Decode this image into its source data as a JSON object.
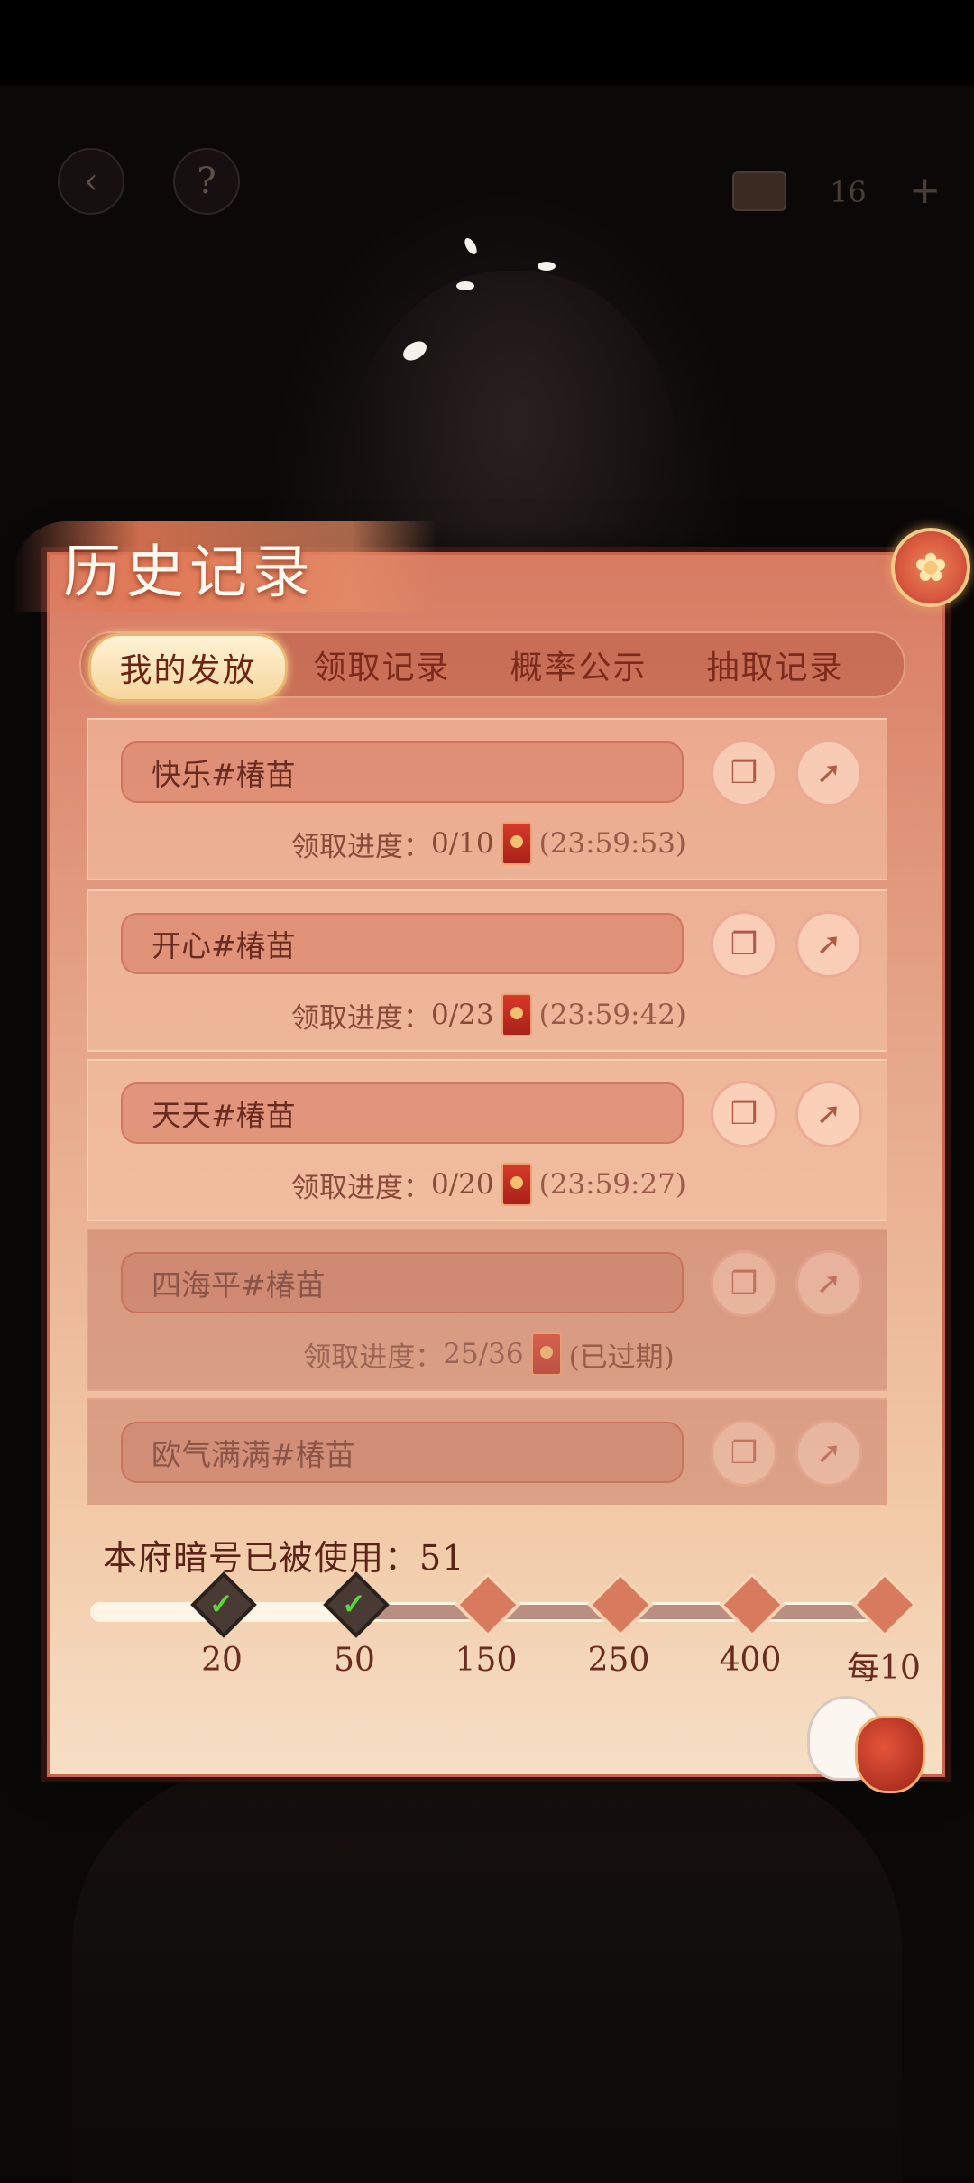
{
  "top_hud": {
    "back_icon": "back-arrow-icon",
    "help_icon": "question-icon",
    "currency_icon": "chest-icon",
    "currency_value": "16",
    "add_label": "+"
  },
  "panel": {
    "title": "历史记录",
    "tabs": [
      {
        "label": "我的发放",
        "active": true
      },
      {
        "label": "领取记录",
        "active": false
      },
      {
        "label": "概率公示",
        "active": false
      },
      {
        "label": "抽取记录",
        "active": false
      }
    ],
    "records": [
      {
        "name": "快乐#椿苗",
        "progress_label": "领取进度：",
        "progress": "0/10",
        "timer": "(23:59:53)",
        "expired": false
      },
      {
        "name": "开心#椿苗",
        "progress_label": "领取进度：",
        "progress": "0/23",
        "timer": "(23:59:42)",
        "expired": false
      },
      {
        "name": "天天#椿苗",
        "progress_label": "领取进度：",
        "progress": "0/20",
        "timer": "(23:59:27)",
        "expired": false
      },
      {
        "name": "四海平#椿苗",
        "progress_label": "领取进度：",
        "progress": "25/36",
        "timer": "(已过期)",
        "expired": true
      },
      {
        "name": "欧气满满#椿苗",
        "progress_label": "",
        "progress": "",
        "timer": "",
        "expired": true
      }
    ],
    "usage": {
      "label": "本府暗号已被使用：",
      "count": "51",
      "milestones": [
        {
          "label": "20",
          "reached": true
        },
        {
          "label": "50",
          "reached": true
        },
        {
          "label": "150",
          "reached": false
        },
        {
          "label": "250",
          "reached": false
        },
        {
          "label": "400",
          "reached": false
        },
        {
          "label": "每10",
          "reached": false
        }
      ],
      "progress_fraction": 0.32
    }
  },
  "colors": {
    "panel_top": "#d87b63",
    "panel_bottom": "#f6dfc5",
    "accent": "#c9654d",
    "check": "#5cd640"
  }
}
